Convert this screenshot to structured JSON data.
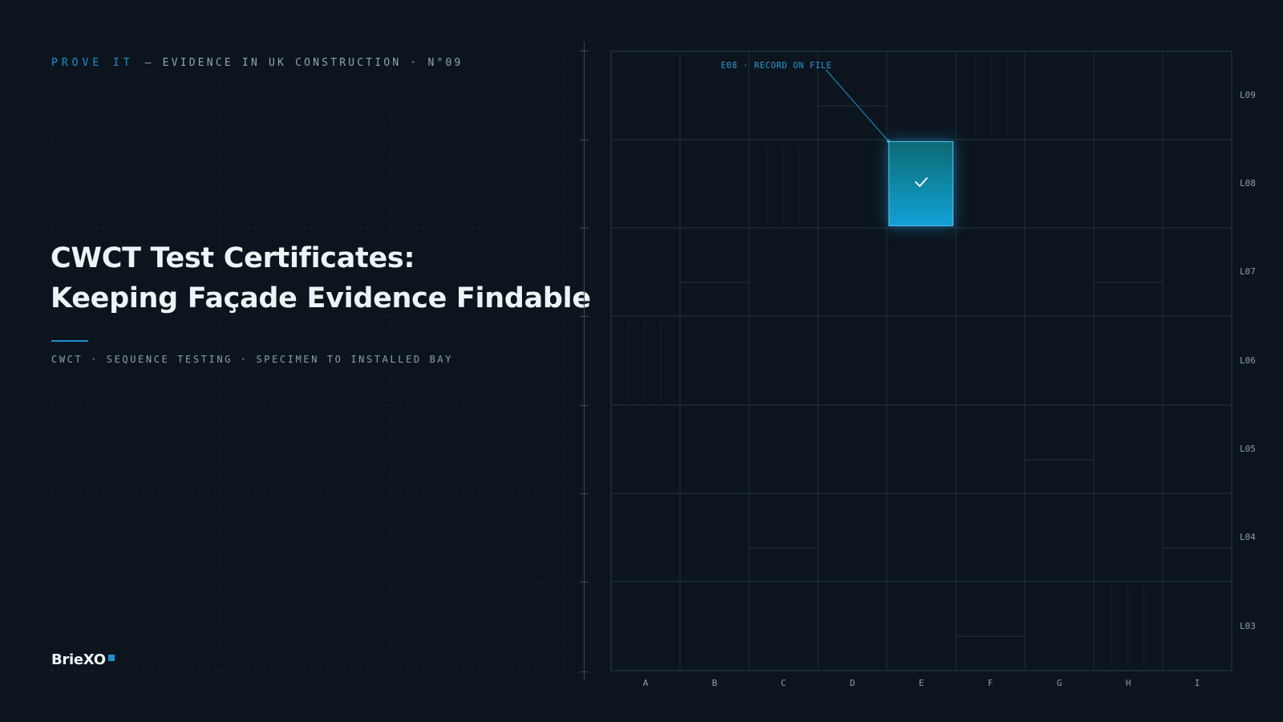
{
  "kicker": {
    "accent": "PROVE IT",
    "rest": "— EVIDENCE IN UK CONSTRUCTION · N°09"
  },
  "title": {
    "line1": "CWCT Test Certificates:",
    "line2": "Keeping Façade Evidence Findable"
  },
  "subtitle": "CWCT · SEQUENCE TESTING · SPECIMEN TO INSTALLED BAY",
  "brand": "BrieXO",
  "grid": {
    "columns": [
      "A",
      "B",
      "C",
      "D",
      "E",
      "F",
      "G",
      "H",
      "I"
    ],
    "rows": [
      "L09",
      "L08",
      "L07",
      "L06",
      "L05",
      "L04",
      "L03"
    ],
    "highlight": {
      "column": "E",
      "row": "L08",
      "label": "E08 · RECORD ON FILE",
      "status": "check-icon"
    }
  },
  "colors": {
    "accent": "#1f8fd0",
    "background": "#0c151d",
    "bay_fill": "#129fd8",
    "text": "#eef3f6"
  }
}
